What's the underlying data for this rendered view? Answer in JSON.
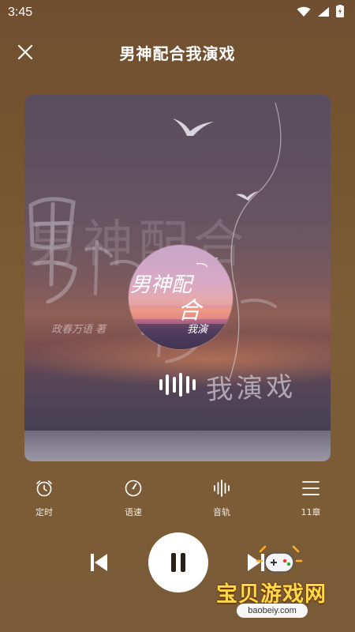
{
  "status_bar": {
    "time": "3:45",
    "icons": [
      "wifi-icon",
      "signal-icon",
      "battery-charging-icon"
    ]
  },
  "header": {
    "title": "男神配合我演戏",
    "close_icon": "close-icon"
  },
  "cover": {
    "title_art_line1": "男神配合",
    "title_art_line2": "我演戏",
    "subtitle_art": "政春万语 著",
    "disc_line1": "男神配",
    "disc_line2": "合",
    "disc_line3": "我演",
    "playing_icon": "sound-wave-icon"
  },
  "tools": [
    {
      "label": "定时",
      "icon": "alarm-clock-icon"
    },
    {
      "label": "语速",
      "icon": "speed-dial-icon"
    },
    {
      "label": "音轨",
      "icon": "audio-track-icon"
    },
    {
      "label": "11章",
      "icon": "chapter-list-icon"
    }
  ],
  "controls": {
    "prev_icon": "skip-previous-icon",
    "pause_icon": "pause-icon",
    "next_icon": "skip-next-icon"
  },
  "watermark": {
    "text": "宝贝游戏网",
    "url": "baobeiy.com"
  },
  "colors": {
    "background": "#74542f",
    "watermark_text": "#ffd84a",
    "accent": "#ffffff"
  }
}
